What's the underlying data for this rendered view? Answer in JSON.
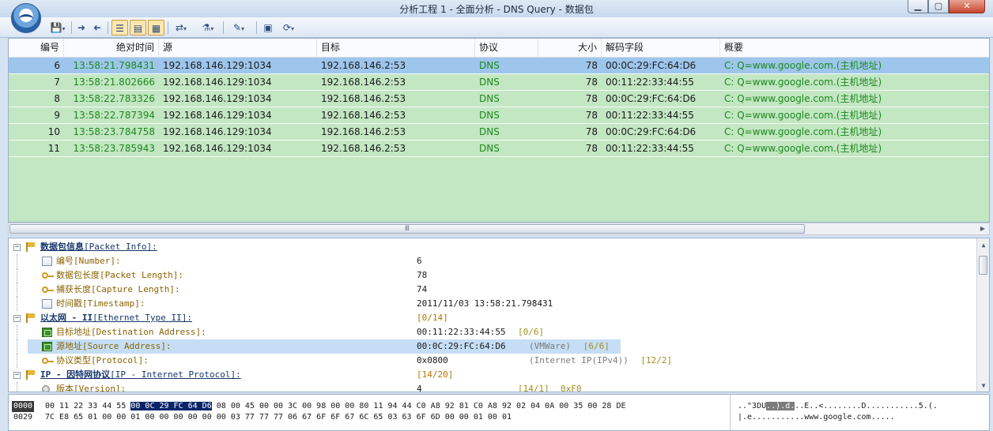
{
  "window": {
    "title": "分析工程 1 - 全面分析 - DNS Query - 数据包",
    "controls": {
      "minimize": "▁",
      "maximize": "▢",
      "close": "✕"
    }
  },
  "toolbar": {
    "icons": [
      "save-icon",
      "back-arrow-icon",
      "forward-arrow-icon",
      "list-view-icon",
      "detail-view-icon",
      "hex-view-icon",
      "export-icon",
      "filter-icon",
      "decode-icon",
      "bookmark-icon",
      "refresh-icon"
    ]
  },
  "packet_list": {
    "columns": [
      "编号",
      "绝对时间",
      "源",
      "目标",
      "协议",
      "大小",
      "解码字段",
      "概要"
    ],
    "rows": [
      {
        "no": "6",
        "time": "13:58:21.798431",
        "src": "192.168.146.129:1034",
        "dst": "192.168.146.2:53",
        "proto": "DNS",
        "size": "78",
        "decode": "00:0C:29:FC:64:D6",
        "summary": "C: Q=www.google.com.(主机地址)"
      },
      {
        "no": "7",
        "time": "13:58:21.802666",
        "src": "192.168.146.129:1034",
        "dst": "192.168.146.2:53",
        "proto": "DNS",
        "size": "78",
        "decode": "00:11:22:33:44:55",
        "summary": "C: Q=www.google.com.(主机地址)"
      },
      {
        "no": "8",
        "time": "13:58:22.783326",
        "src": "192.168.146.129:1034",
        "dst": "192.168.146.2:53",
        "proto": "DNS",
        "size": "78",
        "decode": "00:0C:29:FC:64:D6",
        "summary": "C: Q=www.google.com.(主机地址)"
      },
      {
        "no": "9",
        "time": "13:58:22.787394",
        "src": "192.168.146.129:1034",
        "dst": "192.168.146.2:53",
        "proto": "DNS",
        "size": "78",
        "decode": "00:11:22:33:44:55",
        "summary": "C: Q=www.google.com.(主机地址)"
      },
      {
        "no": "10",
        "time": "13:58:23.784758",
        "src": "192.168.146.129:1034",
        "dst": "192.168.146.2:53",
        "proto": "DNS",
        "size": "78",
        "decode": "00:0C:29:FC:64:D6",
        "summary": "C: Q=www.google.com.(主机地址)"
      },
      {
        "no": "11",
        "time": "13:58:23.785943",
        "src": "192.168.146.129:1034",
        "dst": "192.168.146.2:53",
        "proto": "DNS",
        "size": "78",
        "decode": "00:11:22:33:44:55",
        "summary": "C: Q=www.google.com.(主机地址)"
      }
    ],
    "selected_row": 0,
    "scroll_grip": "Ⅲ"
  },
  "detail_tree": {
    "nodes": [
      {
        "level": 0,
        "cn": "数据包信息",
        "en": "[Packet Info]:",
        "value": "",
        "range": ""
      },
      {
        "level": 1,
        "icon": "doc",
        "cn": "编号",
        "en": "[Number]:",
        "value": "6"
      },
      {
        "level": 1,
        "icon": "key",
        "cn": "数据包长度",
        "en": "[Packet Length]:",
        "value": "78"
      },
      {
        "level": 1,
        "icon": "key",
        "cn": "捕获长度",
        "en": "[Capture Length]:",
        "value": "74"
      },
      {
        "level": 1,
        "icon": "doc",
        "cn": "时间戳",
        "en": "[Timestamp]:",
        "value": "2011/11/03 13:58:21.798431"
      },
      {
        "level": 0,
        "cn": "以太网 - II",
        "en": "[Ethernet Type II]:",
        "range": "[0/14]"
      },
      {
        "level": 1,
        "icon": "net",
        "cn": "目标地址",
        "en": "[Destination Address]:",
        "value": "00:11:22:33:44:55",
        "range": "[0/6]"
      },
      {
        "level": 1,
        "icon": "net",
        "cn": "源地址",
        "en": "[Source Address]:",
        "value": "00:0C:29:FC:64:D6",
        "note": "(VMWare)",
        "range": "[6/6]"
      },
      {
        "level": 1,
        "icon": "key",
        "cn": "协议类型",
        "en": "[Protocol]:",
        "value": "0x0800",
        "note": "(Internet IP(IPv4))",
        "range": "[12/2]"
      },
      {
        "level": 0,
        "cn": "IP - 因特网协议",
        "en": "[IP - Internet Protocol]:",
        "range": "[14/20]"
      },
      {
        "level": 1,
        "icon": "bullet",
        "cn": "版本",
        "en": "[Version]:",
        "value": "4",
        "range": "[14/1]",
        "extra": "0xF0"
      }
    ],
    "selected_index": 7
  },
  "hex": {
    "lines": [
      {
        "offset": "0000",
        "pre": "00 11 22 33 44 55 ",
        "hl": "00 0C 29 FC 64 D6",
        "post": " 08 00 45 00 00 3C 00 98 00 00 80 11 94 44 C0 A8 92 81 C0 A8 92 02 04 0A 00 35 00 28 DE",
        "ascii_pre": "..\"3DU",
        "ascii_hl": "..).d.",
        "ascii_post": "..E..<........D...........5.(."
      },
      {
        "offset": "0029",
        "pre": "7C E8 65 01 00 00 01 00 00 00 00 00 00 03 77 77 77 06 67 6F 6F 67 6C 65 03 63 6F 6D 00 00 01 00 01",
        "hl": "",
        "post": "",
        "ascii_pre": "|.e...........www.google.com.....",
        "ascii_hl": "",
        "ascii_post": ""
      }
    ]
  },
  "colors": {
    "list_bg": "#c3e6c3",
    "selected_row": "#9ec6ec",
    "protocol_text": "#1b8a1b",
    "tree_main_text": "#17366b",
    "tree_sub_text": "#8a6400"
  }
}
